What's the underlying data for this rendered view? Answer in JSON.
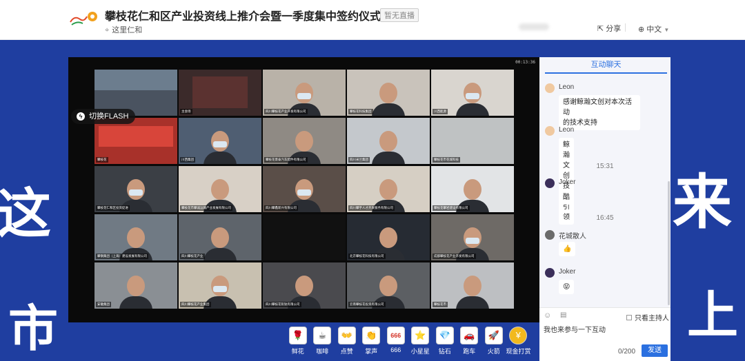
{
  "header": {
    "title": "攀枝花仁和区产业投资线上推介会暨一季度集中签约仪式",
    "badge": "暂无直播",
    "host": "这里仁和",
    "share": "分享",
    "language": "中文"
  },
  "background": {
    "left_char": "这",
    "left_char2": "市",
    "right_char": "来",
    "right_char2": "上"
  },
  "video": {
    "timer": "00:13:36",
    "flash_button": "切换FLASH",
    "tiles": [
      {
        "label": "",
        "bg": "#6c7d8e",
        "mask": false,
        "kind": "room"
      },
      {
        "label": "主会场",
        "bg": "#3b2a2a",
        "mask": false,
        "kind": "screen"
      },
      {
        "label": "四川攀枝花产业开发有限公司",
        "bg": "#b9b2a8",
        "mask": true,
        "kind": "person"
      },
      {
        "label": "攀枝花科技集团",
        "bg": "#c9c3bb",
        "mask": false,
        "kind": "person"
      },
      {
        "label": "川西能源",
        "bg": "#d9d5cf",
        "mask": true,
        "kind": "person"
      },
      {
        "label": "攀枝花",
        "bg": "#a8312a",
        "mask": false,
        "kind": "banner"
      },
      {
        "label": "川西集团",
        "bg": "#4f5e72",
        "mask": true,
        "kind": "person"
      },
      {
        "label": "攀枝花景泰汽车配件有限公司",
        "bg": "#8f8a84",
        "mask": false,
        "kind": "person"
      },
      {
        "label": "四川米兰集团",
        "bg": "#c4c8cc",
        "mask": false,
        "kind": "person"
      },
      {
        "label": "攀枝花市花城科技",
        "bg": "#bfc2c3",
        "mask": false,
        "kind": "empty"
      },
      {
        "label": "攀枝花仁和区投资促进",
        "bg": "#3b3f45",
        "mask": true,
        "kind": "person"
      },
      {
        "label": "攀枝花市攀诚运输产业发展有限公司",
        "bg": "#d8d0c6",
        "mask": false,
        "kind": "person"
      },
      {
        "label": "四川攀鑫新兴有限公司",
        "bg": "#5a4e48",
        "mask": true,
        "kind": "person"
      },
      {
        "label": "四川攀宇人才开发服务有限公司",
        "bg": "#d6cfc4",
        "mask": false,
        "kind": "person"
      },
      {
        "label": "攀枝花攀岩建设有限公司",
        "bg": "#e2e4e6",
        "mask": false,
        "kind": "person"
      },
      {
        "label": "攀钢集团（上海）建设发展有限公司",
        "bg": "#707a84",
        "mask": false,
        "kind": "person"
      },
      {
        "label": "四川攀枝花产业",
        "bg": "#5e646b",
        "mask": false,
        "kind": "person"
      },
      {
        "label": "",
        "bg": "#111111",
        "mask": false,
        "kind": "dark"
      },
      {
        "label": "北京攀枝花科技有限公司",
        "bg": "#262b33",
        "mask": false,
        "kind": "person"
      },
      {
        "label": "成都攀枝花产业开发有限公司",
        "bg": "#6e6a66",
        "mask": true,
        "kind": "person"
      },
      {
        "label": "安徽集团",
        "bg": "#8a8f94",
        "mask": false,
        "kind": "person"
      },
      {
        "label": "四川攀枝花产业集团",
        "bg": "#c8c0b0",
        "mask": true,
        "kind": "person"
      },
      {
        "label": "四川攀枝花钒钛有限公司",
        "bg": "#4a4a4e",
        "mask": false,
        "kind": "person"
      },
      {
        "label": "云南攀枝花投资有限公司",
        "bg": "#5c5f63",
        "mask": false,
        "kind": "person"
      },
      {
        "label": "攀枝花市",
        "bg": "#bdbfc2",
        "mask": false,
        "kind": "person"
      }
    ]
  },
  "chat": {
    "tab": "互动聊天",
    "messages": [
      {
        "user": "Leon",
        "text1": "感谢鲸瀚文创对本次活动",
        "text2": "的技术支持"
      },
      {
        "user": "Leon",
        "text1": "鲸瀚文创技术引领",
        "text2": ""
      },
      {
        "time": "15:31"
      },
      {
        "user": "Joker",
        "text1": "酷",
        "text2": ""
      },
      {
        "time": "16:45"
      },
      {
        "user": "花城散人",
        "text1": "👍",
        "text2": ""
      },
      {
        "user": "Joker",
        "text1": "😝",
        "text2": ""
      }
    ],
    "only_host": "只看主持人",
    "input_placeholder": "我也来参与一下互动",
    "counter": "0/200",
    "send": "发送"
  },
  "gifts": [
    {
      "label": "鲜花",
      "icon": "flower-icon",
      "glyph": "🌹"
    },
    {
      "label": "咖啡",
      "icon": "coffee-icon",
      "glyph": "☕"
    },
    {
      "label": "点赞",
      "icon": "like-icon",
      "glyph": "👐"
    },
    {
      "label": "掌声",
      "icon": "applause-icon",
      "glyph": "👏"
    },
    {
      "label": "666",
      "icon": "666-icon",
      "glyph": "666"
    },
    {
      "label": "小星星",
      "icon": "star-icon",
      "glyph": "⭐"
    },
    {
      "label": "钻石",
      "icon": "diamond-icon",
      "glyph": "💎"
    },
    {
      "label": "跑车",
      "icon": "car-icon",
      "glyph": "🚗"
    },
    {
      "label": "火箭",
      "icon": "rocket-icon",
      "glyph": "🚀"
    },
    {
      "label": "现金打赏",
      "icon": "cash-icon",
      "glyph": "¥"
    }
  ]
}
